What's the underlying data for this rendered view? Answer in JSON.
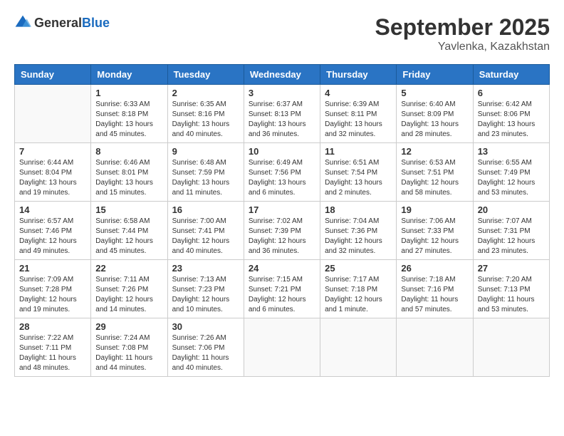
{
  "logo": {
    "general": "General",
    "blue": "Blue"
  },
  "title": {
    "month": "September 2025",
    "location": "Yavlenka, Kazakhstan"
  },
  "headers": [
    "Sunday",
    "Monday",
    "Tuesday",
    "Wednesday",
    "Thursday",
    "Friday",
    "Saturday"
  ],
  "weeks": [
    [
      {
        "day": "",
        "info": ""
      },
      {
        "day": "1",
        "info": "Sunrise: 6:33 AM\nSunset: 8:18 PM\nDaylight: 13 hours\nand 45 minutes."
      },
      {
        "day": "2",
        "info": "Sunrise: 6:35 AM\nSunset: 8:16 PM\nDaylight: 13 hours\nand 40 minutes."
      },
      {
        "day": "3",
        "info": "Sunrise: 6:37 AM\nSunset: 8:13 PM\nDaylight: 13 hours\nand 36 minutes."
      },
      {
        "day": "4",
        "info": "Sunrise: 6:39 AM\nSunset: 8:11 PM\nDaylight: 13 hours\nand 32 minutes."
      },
      {
        "day": "5",
        "info": "Sunrise: 6:40 AM\nSunset: 8:09 PM\nDaylight: 13 hours\nand 28 minutes."
      },
      {
        "day": "6",
        "info": "Sunrise: 6:42 AM\nSunset: 8:06 PM\nDaylight: 13 hours\nand 23 minutes."
      }
    ],
    [
      {
        "day": "7",
        "info": "Sunrise: 6:44 AM\nSunset: 8:04 PM\nDaylight: 13 hours\nand 19 minutes."
      },
      {
        "day": "8",
        "info": "Sunrise: 6:46 AM\nSunset: 8:01 PM\nDaylight: 13 hours\nand 15 minutes."
      },
      {
        "day": "9",
        "info": "Sunrise: 6:48 AM\nSunset: 7:59 PM\nDaylight: 13 hours\nand 11 minutes."
      },
      {
        "day": "10",
        "info": "Sunrise: 6:49 AM\nSunset: 7:56 PM\nDaylight: 13 hours\nand 6 minutes."
      },
      {
        "day": "11",
        "info": "Sunrise: 6:51 AM\nSunset: 7:54 PM\nDaylight: 13 hours\nand 2 minutes."
      },
      {
        "day": "12",
        "info": "Sunrise: 6:53 AM\nSunset: 7:51 PM\nDaylight: 12 hours\nand 58 minutes."
      },
      {
        "day": "13",
        "info": "Sunrise: 6:55 AM\nSunset: 7:49 PM\nDaylight: 12 hours\nand 53 minutes."
      }
    ],
    [
      {
        "day": "14",
        "info": "Sunrise: 6:57 AM\nSunset: 7:46 PM\nDaylight: 12 hours\nand 49 minutes."
      },
      {
        "day": "15",
        "info": "Sunrise: 6:58 AM\nSunset: 7:44 PM\nDaylight: 12 hours\nand 45 minutes."
      },
      {
        "day": "16",
        "info": "Sunrise: 7:00 AM\nSunset: 7:41 PM\nDaylight: 12 hours\nand 40 minutes."
      },
      {
        "day": "17",
        "info": "Sunrise: 7:02 AM\nSunset: 7:39 PM\nDaylight: 12 hours\nand 36 minutes."
      },
      {
        "day": "18",
        "info": "Sunrise: 7:04 AM\nSunset: 7:36 PM\nDaylight: 12 hours\nand 32 minutes."
      },
      {
        "day": "19",
        "info": "Sunrise: 7:06 AM\nSunset: 7:33 PM\nDaylight: 12 hours\nand 27 minutes."
      },
      {
        "day": "20",
        "info": "Sunrise: 7:07 AM\nSunset: 7:31 PM\nDaylight: 12 hours\nand 23 minutes."
      }
    ],
    [
      {
        "day": "21",
        "info": "Sunrise: 7:09 AM\nSunset: 7:28 PM\nDaylight: 12 hours\nand 19 minutes."
      },
      {
        "day": "22",
        "info": "Sunrise: 7:11 AM\nSunset: 7:26 PM\nDaylight: 12 hours\nand 14 minutes."
      },
      {
        "day": "23",
        "info": "Sunrise: 7:13 AM\nSunset: 7:23 PM\nDaylight: 12 hours\nand 10 minutes."
      },
      {
        "day": "24",
        "info": "Sunrise: 7:15 AM\nSunset: 7:21 PM\nDaylight: 12 hours\nand 6 minutes."
      },
      {
        "day": "25",
        "info": "Sunrise: 7:17 AM\nSunset: 7:18 PM\nDaylight: 12 hours\nand 1 minute."
      },
      {
        "day": "26",
        "info": "Sunrise: 7:18 AM\nSunset: 7:16 PM\nDaylight: 11 hours\nand 57 minutes."
      },
      {
        "day": "27",
        "info": "Sunrise: 7:20 AM\nSunset: 7:13 PM\nDaylight: 11 hours\nand 53 minutes."
      }
    ],
    [
      {
        "day": "28",
        "info": "Sunrise: 7:22 AM\nSunset: 7:11 PM\nDaylight: 11 hours\nand 48 minutes."
      },
      {
        "day": "29",
        "info": "Sunrise: 7:24 AM\nSunset: 7:08 PM\nDaylight: 11 hours\nand 44 minutes."
      },
      {
        "day": "30",
        "info": "Sunrise: 7:26 AM\nSunset: 7:06 PM\nDaylight: 11 hours\nand 40 minutes."
      },
      {
        "day": "",
        "info": ""
      },
      {
        "day": "",
        "info": ""
      },
      {
        "day": "",
        "info": ""
      },
      {
        "day": "",
        "info": ""
      }
    ]
  ]
}
